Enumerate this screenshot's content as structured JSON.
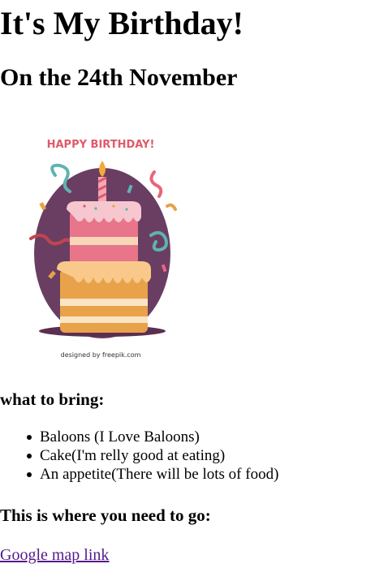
{
  "page": {
    "title": "It's My Birthday!",
    "subtitle": "On the 24th November"
  },
  "image": {
    "banner_text": "HAPPY BIRTHDAY!",
    "credit_text": "designed by freepik.com",
    "icon": "birthday-cake-illustration"
  },
  "bring": {
    "heading": "what to bring:",
    "items": [
      "Baloons (I Love Baloons)",
      "Cake(I'm relly good at eating)",
      "An appetite(There will be lots of food)"
    ]
  },
  "location": {
    "heading": "This is where you need to go:",
    "link_text": "Google map link"
  },
  "colors": {
    "link": "#551a8b",
    "text": "#000000",
    "background": "#ffffff",
    "circle": "#6a3e62",
    "banner": "#e05a6a"
  }
}
